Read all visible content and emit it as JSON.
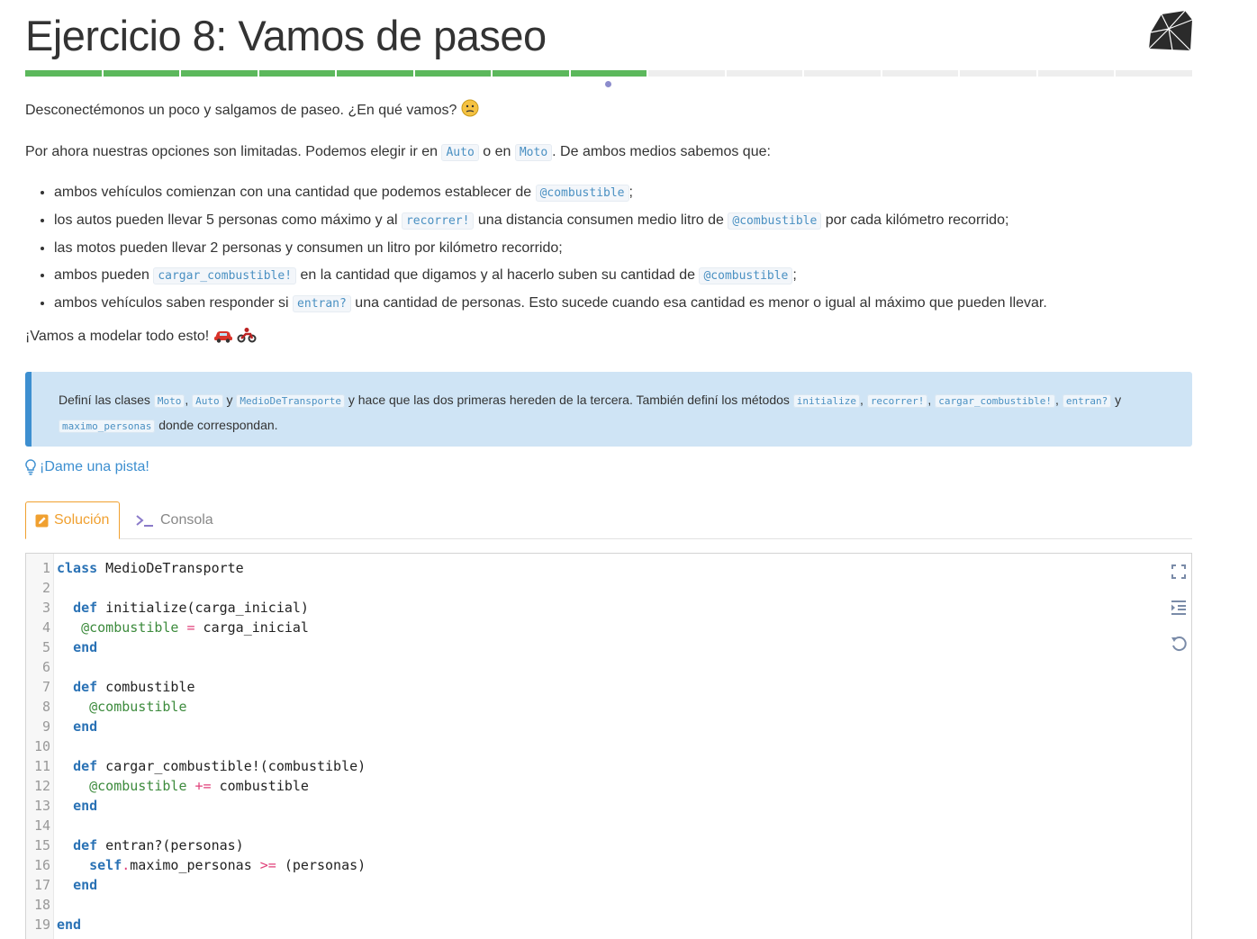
{
  "header": {
    "title": "Ejercicio 8: Vamos de paseo"
  },
  "progress": {
    "segments_total": 15,
    "segments_done": 8,
    "current_index": 8
  },
  "intro": {
    "line1": "Desconectémonos un poco y salgamos de paseo. ¿En qué vamos?",
    "line2_a": "Por ahora nuestras opciones son limitadas. Podemos elegir ir en",
    "line2_code1": "Auto",
    "line2_b": "o en",
    "line2_code2": "Moto",
    "line2_c": ". De ambos medios sabemos que:"
  },
  "requirements": {
    "item1_a": "ambos vehículos comienzan con una cantidad que podemos establecer de",
    "item1_code": "@combustible",
    "item1_b": ";",
    "item2_a": "los autos pueden llevar 5 personas como máximo y al",
    "item2_code1": "recorrer!",
    "item2_b": "una distancia consumen medio litro de",
    "item2_code2": "@combustible",
    "item2_c": "por cada kilómetro recorrido;",
    "item3": "las motos pueden llevar 2 personas y consumen un litro por kilómetro recorrido;",
    "item4_a": "ambos pueden",
    "item4_code1": "cargar_combustible!",
    "item4_b": "en la cantidad que digamos y al hacerlo suben su cantidad de",
    "item4_code2": "@combustible",
    "item4_c": ";",
    "item5_a": "ambos vehículos saben responder si",
    "item5_code": "entran?",
    "item5_b": "una cantidad de personas. Esto sucede cuando esa cantidad es menor o igual al máximo que pueden llevar."
  },
  "outro": {
    "text": "¡Vamos a modelar todo esto!"
  },
  "task": {
    "a": "Definí las clases",
    "c1": "Moto",
    "sep1": ",",
    "c2": "Auto",
    "y1": "y",
    "c3": "MedioDeTransporte",
    "b": "y hace que las dos primeras hereden de la tercera. También definí los métodos",
    "m1": "initialize",
    "sep2": ",",
    "m2": "recorrer!",
    "sep3": ",",
    "m3": "cargar_combustible!",
    "sep4": ",",
    "m4": "entran?",
    "y2": "y",
    "m5": "maximo_personas",
    "c": "donde correspondan."
  },
  "hint": {
    "label": "¡Dame una pista!",
    "icon": "lightbulb-icon"
  },
  "tabs": [
    {
      "label": "Solución",
      "icon": "edit-icon",
      "active": true
    },
    {
      "label": "Consola",
      "icon": "terminal-icon",
      "active": false
    }
  ],
  "editor": {
    "tools": [
      "fullscreen-icon",
      "indent-icon",
      "reset-icon"
    ],
    "lines": [
      {
        "n": "1"
      },
      {
        "n": "2"
      },
      {
        "n": "3"
      },
      {
        "n": "4"
      },
      {
        "n": "5"
      },
      {
        "n": "6"
      },
      {
        "n": "7"
      },
      {
        "n": "8"
      },
      {
        "n": "9"
      },
      {
        "n": "10"
      },
      {
        "n": "11"
      },
      {
        "n": "12"
      },
      {
        "n": "13"
      },
      {
        "n": "14"
      },
      {
        "n": "15"
      },
      {
        "n": "16"
      },
      {
        "n": "17"
      },
      {
        "n": "18"
      },
      {
        "n": "19"
      }
    ],
    "tokens": {
      "class": "class",
      "class_name": " MedioDeTransporte",
      "def": "def",
      "end": "end",
      "self": "self",
      "l3": " initialize(carga_inicial)",
      "l4_ivar": "@combustible",
      "l4_op": "=",
      "l4_rest": " carga_inicial",
      "l7": " combustible",
      "l8_ivar": "@combustible",
      "l11": " cargar_combustible!(combustible)",
      "l12_ivar": "@combustible",
      "l12_op": "+=",
      "l12_rest": " combustible",
      "l15": " entran?(personas)",
      "l16_dot": ".",
      "l16_mid": "maximo_personas ",
      "l16_op": ">=",
      "l16_rest": " (personas)"
    }
  },
  "colors": {
    "progress_done": "#5cb85c",
    "accent": "#f0a030",
    "link": "#3d8fd0",
    "callout_bg": "#cfe4f5"
  }
}
